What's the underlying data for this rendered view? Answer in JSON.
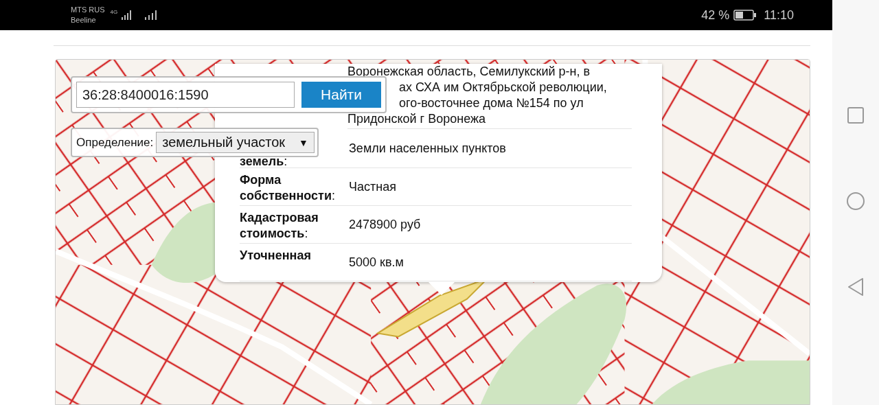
{
  "status_bar": {
    "carrier_1": "MTS RUS",
    "network_type": "4G",
    "carrier_2": "Beeline",
    "battery_percent": "42 %",
    "time": "11:10"
  },
  "search": {
    "value": "36:28:8400016:1590",
    "button": "Найти"
  },
  "definition": {
    "label": "Определение:",
    "value": "земельный участок",
    "arrow": "▼"
  },
  "popup": {
    "address_lines": [
      "Воронежская область, Семилукский р-н, в",
      "ах СХА им Октябрьской революции,",
      "ого-восточнее дома №154 по ул",
      "Придонской г Воронежа"
    ],
    "rows": [
      {
        "label": "**земель**:",
        "value": "Земли населенных пунктов"
      },
      {
        "label": "**Форма собственности**:",
        "value": "Частная"
      },
      {
        "label": "**Кадастровая стоимость**:",
        "value": "2478900 руб"
      },
      {
        "label": "**Уточненная**",
        "value": "5000 кв.м"
      }
    ]
  }
}
